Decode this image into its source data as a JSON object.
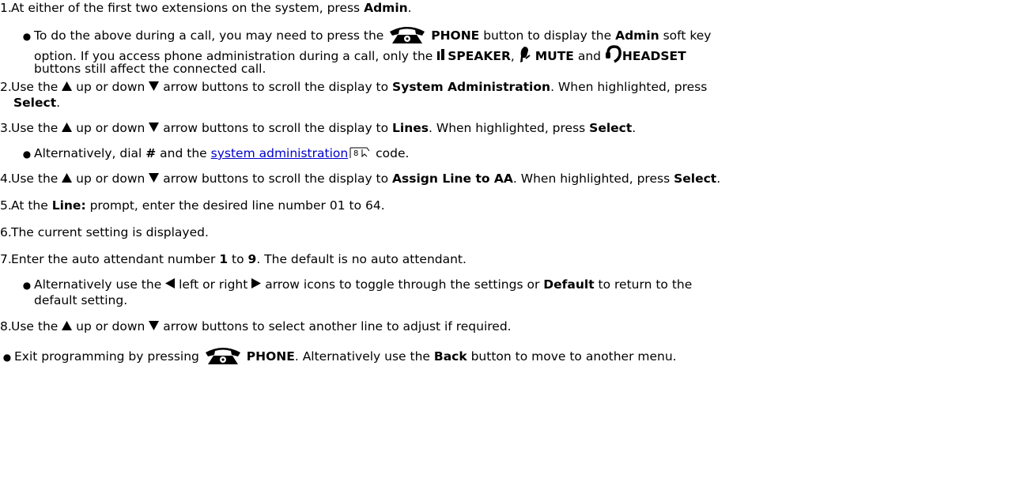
{
  "steps": [
    {
      "num": "1.",
      "a": "At either of the first two extensions on the system, press ",
      "b": "Admin",
      "c": "."
    },
    {
      "num": "2.",
      "a": "Use the ",
      "b1": " up or down ",
      "b2": " arrow buttons to scroll the display to ",
      "bold": "System Administration",
      "c": ". When highlighted, press",
      "select": "Select",
      "d": "."
    },
    {
      "num": "3.",
      "a": "Use the ",
      "b1": " up or down ",
      "b2": " arrow buttons to scroll the display to ",
      "bold": "Lines",
      "c": ". When highlighted, press ",
      "select": "Select",
      "d": "."
    },
    {
      "num": "4.",
      "a": "Use the ",
      "b1": " up or down ",
      "b2": " arrow buttons to scroll the display to ",
      "bold": "Assign Line to AA",
      "c": ". When highlighted, press ",
      "select": "Select",
      "d": "."
    },
    {
      "num": "5.",
      "a": "At the ",
      "bold": "Line:",
      "c": " prompt, enter the desired line number 01 to 64."
    },
    {
      "num": "6.",
      "a": "The current setting is displayed."
    },
    {
      "num": "7.",
      "a": "Enter the auto attendant number ",
      "b1": "1",
      "b2": " to ",
      "b3": "9",
      "c": ".  The default is no auto attendant."
    },
    {
      "num": "8.",
      "a": "Use the ",
      "b1": " up or down ",
      "b2": " arrow buttons to select another line to adjust if required."
    }
  ],
  "bullet1": {
    "a": "To do the above during a call, you may need to press the ",
    "phone": "PHONE",
    "b": " button to display the ",
    "admin": "Admin",
    "c": " soft key",
    "line2a": "option. If you access phone administration during a call, only the ",
    "speaker": "SPEAKER",
    "comma": ", ",
    "mute": "MUTE",
    "and": " and ",
    "headset": "HEADSET",
    "line3": "buttons still affect the connected call."
  },
  "bullet3": {
    "a": "Alternatively, dial ",
    "hash": "#",
    "b": " and the ",
    "link": "system administration",
    "ref": "8",
    "c": " code."
  },
  "bullet7": {
    "a": "Alternatively use the ",
    "b": " left or right ",
    "c": " arrow icons to toggle through the settings or ",
    "default": "Default",
    "d": " to return to the",
    "line2": "default setting."
  },
  "final": {
    "a": "Exit programming by pressing ",
    "phone": "PHONE",
    "b": ". Alternatively use the ",
    "back": "Back",
    "c": " button to move to another menu."
  },
  "icons": [
    "phone-icon",
    "speaker-icon",
    "mute-icon",
    "headset-icon",
    "up-arrow-icon",
    "down-arrow-icon",
    "left-arrow-icon",
    "right-arrow-icon"
  ],
  "colors": {
    "link": "#0000cc",
    "text": "#000000"
  }
}
